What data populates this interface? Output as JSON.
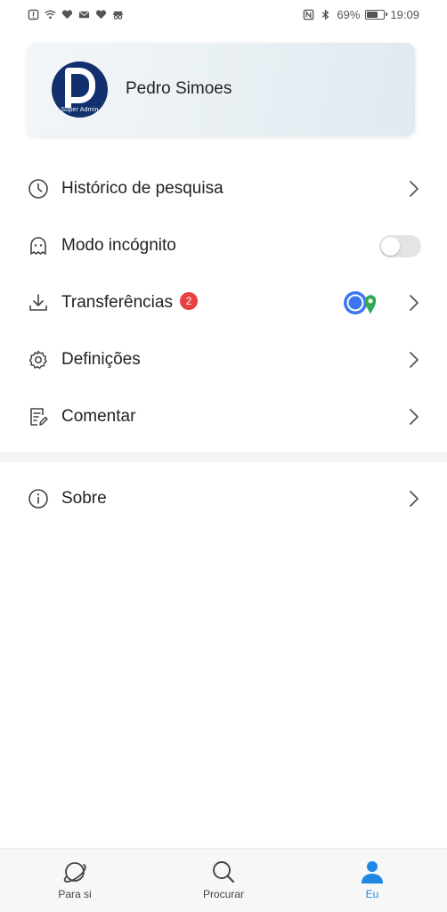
{
  "status_bar": {
    "battery_percent": "69%",
    "time": "19:09",
    "battery_level": 0.69
  },
  "profile": {
    "name": "Pedro Simoes",
    "avatar_caption": "Super Admin"
  },
  "menu": {
    "history_label": "Histórico de pesquisa",
    "incognito_label": "Modo incógnito",
    "incognito_enabled": false,
    "downloads_label": "Transferências",
    "downloads_badge": "2",
    "settings_label": "Definições",
    "feedback_label": "Comentar",
    "about_label": "Sobre"
  },
  "bottom_nav": {
    "for_you_label": "Para si",
    "search_label": "Procurar",
    "me_label": "Eu",
    "active_tab": "me"
  },
  "colors": {
    "accent": "#1e88e5",
    "badge": "#e74141",
    "avatar_bg": "#12306d"
  }
}
